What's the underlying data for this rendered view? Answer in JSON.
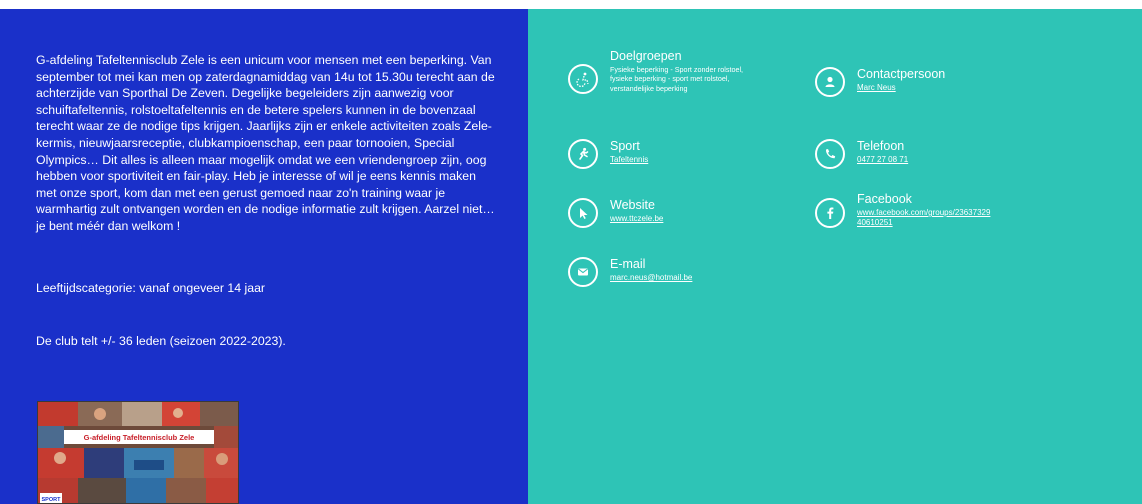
{
  "about": {
    "paragraph": "G-afdeling Tafeltennisclub Zele is een unicum voor mensen met een beperking. Van september tot mei kan men op zaterdagnamiddag van 14u tot 15.30u terecht aan de achterzijde van Sporthal De Zeven. Degelijke begeleiders zijn aanwezig voor schuiftafeltennis, rolstoeltafeltennis en de betere spelers kunnen in de bovenzaal terecht waar ze de nodige tips krijgen. Jaarlijks zijn er enkele activiteiten zoals Zele-kermis, nieuwjaarsreceptie, clubkampioenschap, een paar tornooien, Special Olympics… Dit alles is alleen maar mogelijk omdat we een vriendengroep zijn, oog hebben voor sportiviteit en fair-play. Heb je interesse of wil je eens kennis maken met onze sport, kom dan met een gerust gemoed naar zo'n training waar je warmhartig zult ontvangen worden en de nodige informatie zult krijgen. Aarzel niet… je bent méér dan welkom !",
    "age": "Leeftijdscategorie: vanaf ongeveer 14 jaar",
    "members": "De club telt +/- 36 leden (seizoen 2022-2023).",
    "photo_banner": "G-afdeling Tafeltennisclub Zele",
    "photo_badge": "SPORT"
  },
  "info": {
    "target_groups": {
      "title": "Doelgroepen",
      "lines": [
        "Fysieke beperking - Sport zonder rolstoel,",
        "fysieke beperking - sport met rolstoel,",
        "verstandelijke beperking"
      ],
      "icon": "accessibility-icon"
    },
    "contact": {
      "title": "Contactpersoon",
      "value": "Marc Neus",
      "icon": "person-icon"
    },
    "sport": {
      "title": "Sport",
      "value": "Tafeltennis",
      "icon": "runner-icon"
    },
    "phone": {
      "title": "Telefoon",
      "value": "0477 27 08 71",
      "icon": "phone-icon"
    },
    "website": {
      "title": "Website",
      "value": "www.ttczele.be",
      "icon": "cursor-icon"
    },
    "facebook": {
      "title": "Facebook",
      "value_line1": "www.facebook.com/groups/23637329",
      "value_line2": "40610251",
      "icon": "facebook-icon"
    },
    "email": {
      "title": "E-mail",
      "value": "marc.neus@hotmail.be",
      "icon": "envelope-icon"
    }
  },
  "colors": {
    "left_bg": "#1a30c9",
    "right_bg": "#2ec4b6",
    "text": "#ffffff"
  }
}
